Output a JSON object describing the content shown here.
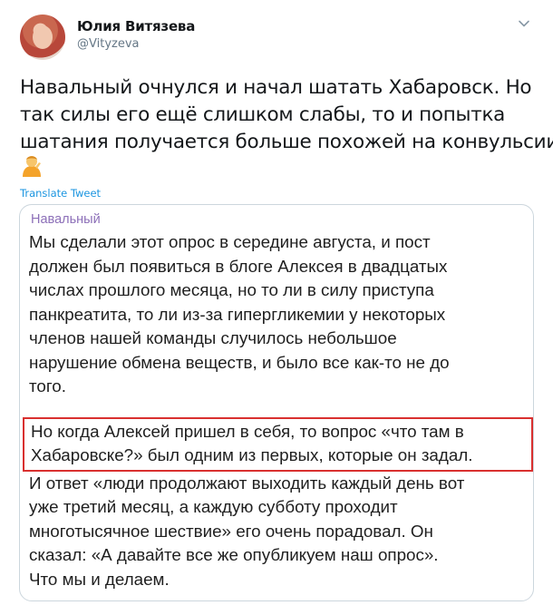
{
  "author": {
    "name": "Юлия Витязева",
    "handle": "@Vityzeva"
  },
  "tweet": {
    "lines": [
      "Навальный очнулся и начал шатать Хабаровск. Но",
      "так силы его ещё слишком слабы, то и попытка",
      "шатания получается больше похожей на конвульсии"
    ],
    "emoji": "person-gesturing-icon",
    "translate_label": "Translate Tweet"
  },
  "quote": {
    "title": "Навальный",
    "paragraph1": [
      "Мы сделали этот опрос в середине августа, и пост",
      "должен был появиться в блоге Алексея в двадцатых",
      "числах прошлого месяца, но то ли в силу приступа",
      "панкреатита, то ли из-за гипергликемии у некоторых",
      "членов нашей команды случилось небольшое",
      "нарушение обмена веществ, и было все как-то не до",
      "того."
    ],
    "highlighted": [
      "Но когда Алексей пришел в себя, то вопрос «что там в",
      "Хабаровске?» был одним из первых, которые он задал."
    ],
    "paragraph2": [
      "И ответ «люди продолжают выходить каждый день вот",
      "уже третий месяц, а каждую субботу проходит",
      "многотысячное шествие» его очень порадовал. Он",
      "сказал: «А давайте все же опубликуем наш опрос».",
      "Что мы и делаем."
    ],
    "highlight_color": "#d9302f",
    "title_color": "#8c6fb8"
  },
  "colors": {
    "link": "#1b95e0",
    "secondary_text": "#657786",
    "border": "#ccd6dd"
  }
}
